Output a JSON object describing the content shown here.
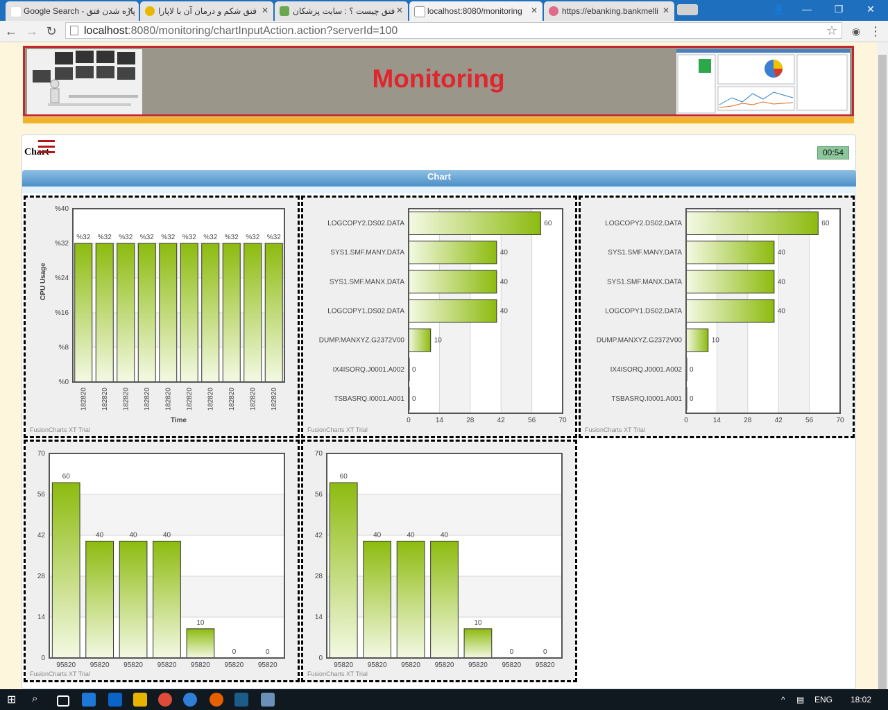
{
  "browser": {
    "tabs": [
      {
        "title": "Google Search - پاره شدن فتق",
        "active": false
      },
      {
        "title": "فتق شکم و درمان آن با لاپارا",
        "active": false
      },
      {
        "title": "فتق چیست ؟ : سایت پزشکان",
        "active": false
      },
      {
        "title": "localhost:8080/monitoring",
        "active": true
      },
      {
        "title": "https://ebanking.bankmelli",
        "active": false
      }
    ],
    "url_host": "localhost",
    "url_rest": ":8080/monitoring/chartInputAction.action?serverId=100"
  },
  "page": {
    "banner_title": "Monitoring",
    "section_label": "Chart",
    "timer": "00:54",
    "chart_bar_title": "Chart",
    "watermark": "FusionCharts XT Trial"
  },
  "taskbar": {
    "lang": "ENG",
    "time": "18:02"
  },
  "colors": {
    "bar_top": "#8dbb0f",
    "bar_bottom": "#f4f9e4",
    "banner_border": "#c0282d",
    "title_red": "#e0252e"
  },
  "chart_data": [
    {
      "type": "bar",
      "categories": [
        "182820",
        "182820",
        "182820",
        "182820",
        "182820",
        "182820",
        "182820",
        "182820",
        "182820",
        "182820"
      ],
      "values": [
        32,
        32,
        32,
        32,
        32,
        32,
        32,
        32,
        32,
        32
      ],
      "value_prefix": "%",
      "xlabel": "Time",
      "ylabel": "CPU Usage",
      "ylim": [
        0,
        40
      ],
      "yticks": [
        0,
        8,
        16,
        24,
        32,
        40
      ]
    },
    {
      "type": "bar",
      "orientation": "horizontal",
      "categories": [
        "LOGCOPY2.DS02.DATA",
        "SYS1.SMF.MANY.DATA",
        "SYS1.SMF.MANX.DATA",
        "LOGCOPY1.DS02.DATA",
        "DUMP.MANXYZ.G2372V00",
        "IX4ISORQ.J0001.A002",
        "TSBASRQ.I0001.A001"
      ],
      "values": [
        60,
        40,
        40,
        40,
        10,
        0,
        0
      ],
      "xlim": [
        0,
        70
      ],
      "xticks": [
        0,
        14,
        28,
        42,
        56,
        70
      ]
    },
    {
      "type": "bar",
      "orientation": "horizontal",
      "categories": [
        "LOGCOPY2.DS02.DATA",
        "SYS1.SMF.MANY.DATA",
        "SYS1.SMF.MANX.DATA",
        "LOGCOPY1.DS02.DATA",
        "DUMP.MANXYZ.G2372V00",
        "IX4ISORQ.J0001.A002",
        "TSBASRQ.I0001.A001"
      ],
      "values": [
        60,
        40,
        40,
        40,
        10,
        0,
        0
      ],
      "xlim": [
        0,
        70
      ],
      "xticks": [
        0,
        14,
        28,
        42,
        56,
        70
      ]
    },
    {
      "type": "bar",
      "categories": [
        "95820",
        "95820",
        "95820",
        "95820",
        "95820",
        "95820",
        "95820"
      ],
      "values": [
        60,
        40,
        40,
        40,
        10,
        0,
        0
      ],
      "ylim": [
        0,
        70
      ],
      "yticks": [
        0,
        14,
        28,
        42,
        56,
        70
      ]
    },
    {
      "type": "bar",
      "categories": [
        "95820",
        "95820",
        "95820",
        "95820",
        "95820",
        "95820",
        "95820"
      ],
      "values": [
        60,
        40,
        40,
        40,
        10,
        0,
        0
      ],
      "ylim": [
        0,
        70
      ],
      "yticks": [
        0,
        14,
        28,
        42,
        56,
        70
      ]
    }
  ]
}
